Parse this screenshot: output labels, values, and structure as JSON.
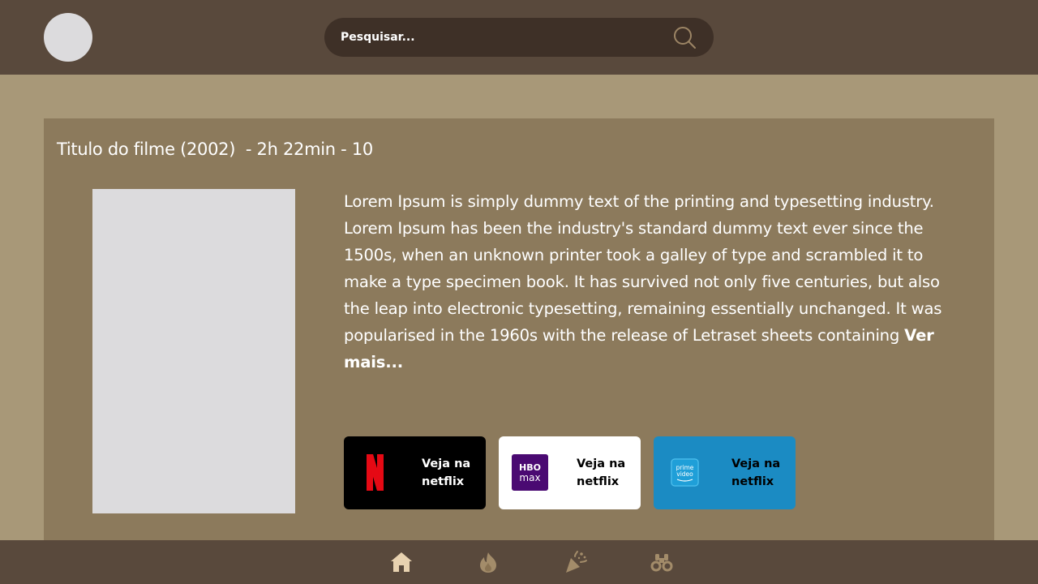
{
  "header": {
    "search": {
      "placeholder": "Pesquisar..."
    },
    "icons": {
      "search": "search-icon",
      "avatar": "user-avatar"
    }
  },
  "movie": {
    "title_line": "Titulo do filme (2002)  - 2h 22min - 10",
    "description": "Lorem Ipsum is simply dummy text of the printing and typesetting industry. Lorem Ipsum has been the industry's standard dummy text ever since the 1500s, when an unknown printer took a galley of type and scrambled it to make a type specimen book. It has survived not only five centuries, but also the leap into electronic typesetting, remaining essentially unchanged. It was popularised in the 1960s with the release of Letraset sheets containing ",
    "see_more": "Ver mais..."
  },
  "streaming": [
    {
      "service": "netflix",
      "logo_icon": "netflix-logo-icon",
      "label": "Veja na netflix",
      "color": "#000000"
    },
    {
      "service": "hbo-max",
      "logo_icon": "hbo-max-logo-icon",
      "logo_text_top": "HBO",
      "logo_text_bottom": "max",
      "label": "Veja na netflix",
      "color": "#ffffff"
    },
    {
      "service": "prime-video",
      "logo_icon": "prime-video-logo-icon",
      "logo_text_top": "prime",
      "logo_text_bottom": "video",
      "label": "Veja na netflix",
      "color": "#1b8bc3"
    }
  ],
  "bottom_nav": [
    {
      "name": "home",
      "icon": "home-icon",
      "active": true
    },
    {
      "name": "trending",
      "icon": "flame-icon",
      "active": false
    },
    {
      "name": "celebrate",
      "icon": "party-popper-icon",
      "active": false
    },
    {
      "name": "explore",
      "icon": "binoculars-icon",
      "active": false
    }
  ],
  "colors": {
    "header_bg": "#59493c",
    "page_bg": "#a89878",
    "card_bg": "#8c7a5c",
    "search_bg": "#3e3027",
    "icon_active": "#e8d2b0",
    "icon_inactive": "#a38c6a"
  }
}
